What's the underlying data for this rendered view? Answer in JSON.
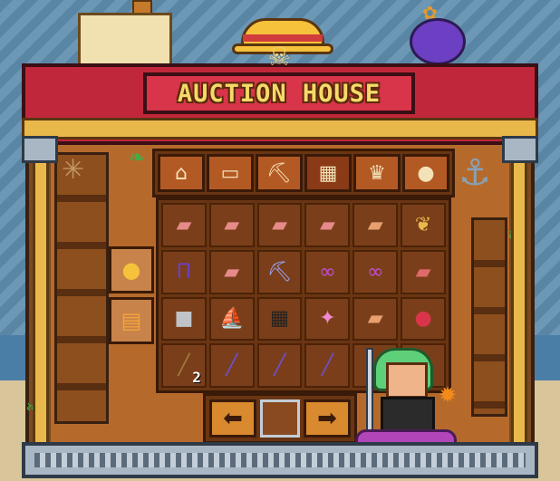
{
  "title": "AUCTION HOUSE",
  "tabs": [
    {
      "icon": "house-icon",
      "glyph": "⌂",
      "active": false
    },
    {
      "icon": "block-icon",
      "glyph": "▭",
      "active": false
    },
    {
      "icon": "pickaxe-icon",
      "glyph": "⛏",
      "active": false
    },
    {
      "icon": "cage-icon",
      "glyph": "▦",
      "active": true
    },
    {
      "icon": "character-icon",
      "glyph": "♛",
      "active": false
    },
    {
      "icon": "fruit-icon",
      "glyph": "●",
      "active": false
    }
  ],
  "side_buttons": [
    {
      "icon": "gold-coin-icon",
      "glyph": "●"
    },
    {
      "icon": "basket-icon",
      "glyph": "▤"
    }
  ],
  "items": [
    {
      "icon": "scroll-icon",
      "glyph": "▰",
      "color": "#e68a8a"
    },
    {
      "icon": "scroll-icon",
      "glyph": "▰",
      "color": "#e68a8a"
    },
    {
      "icon": "scroll-icon",
      "glyph": "▰",
      "color": "#e68a8a"
    },
    {
      "icon": "scroll-icon",
      "glyph": "▰",
      "color": "#e68a8a"
    },
    {
      "icon": "bandage-icon",
      "glyph": "▰",
      "color": "#e8a070"
    },
    {
      "icon": "feather-icon",
      "glyph": "❦",
      "color": "#e9b84a"
    },
    {
      "icon": "pants-icon",
      "glyph": "Π",
      "color": "#6d3fc2"
    },
    {
      "icon": "scroll-icon",
      "glyph": "▰",
      "color": "#e68a8a"
    },
    {
      "icon": "pickaxe-icon",
      "glyph": "⛏",
      "color": "#9aa8ff"
    },
    {
      "icon": "goggles-icon",
      "glyph": "∞",
      "color": "#c04fd0"
    },
    {
      "icon": "goggles-icon",
      "glyph": "∞",
      "color": "#c04fd0"
    },
    {
      "icon": "scroll-icon",
      "glyph": "▰",
      "color": "#e06a6a"
    },
    {
      "icon": "stone-block-icon",
      "glyph": "■",
      "color": "#c0c4c8"
    },
    {
      "icon": "ship-icon",
      "glyph": "⛵",
      "color": "#e8d8c0"
    },
    {
      "icon": "cage-block-icon",
      "glyph": "▦",
      "color": "#222222"
    },
    {
      "icon": "magic-staff-icon",
      "glyph": "✦",
      "color": "#f08ad0"
    },
    {
      "icon": "bandage-icon",
      "glyph": "▰",
      "color": "#e8a070"
    },
    {
      "icon": "red-fruit-icon",
      "glyph": "●",
      "color": "#d8344a"
    },
    {
      "icon": "wooden-stick-icon",
      "glyph": "╱",
      "color": "#a07a3a",
      "count": "2"
    },
    {
      "icon": "fishing-rod-icon",
      "glyph": "╱",
      "color": "#6d4fd0"
    },
    {
      "icon": "fishing-rod-icon",
      "glyph": "╱",
      "color": "#6d4fd0"
    },
    {
      "icon": "fishing-rod-icon",
      "glyph": "╱",
      "color": "#6d4fd0"
    },
    {
      "icon": "empty-slot",
      "glyph": "",
      "color": "#7a3f1a"
    },
    {
      "icon": "empty-slot",
      "glyph": "",
      "color": "#7a3f1a"
    }
  ],
  "pager": {
    "prev": "⬅",
    "next": "➡"
  }
}
